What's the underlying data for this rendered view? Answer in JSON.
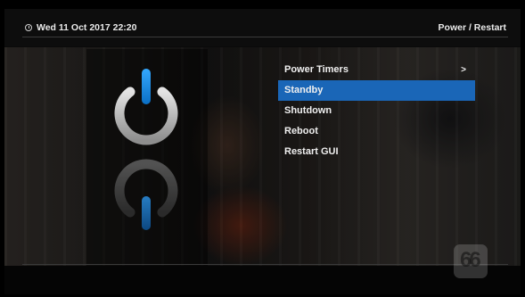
{
  "header": {
    "datetime": "Wed 11 Oct 2017  22:20",
    "title": "Power / Restart"
  },
  "menu": {
    "items": [
      {
        "label": "Power Timers",
        "submenu": ">"
      },
      {
        "label": "Standby"
      },
      {
        "label": "Shutdown"
      },
      {
        "label": "Reboot"
      },
      {
        "label": "Restart GUI"
      }
    ],
    "selected_index": 1
  },
  "colors": {
    "accent": "#1a66b7",
    "power_bar": "#1e8fe8",
    "ring": "#c9c9c9"
  },
  "icons": {
    "power_on": "power-icon",
    "power_off": "power-icon-dimmed",
    "logo": "skin-logo"
  }
}
